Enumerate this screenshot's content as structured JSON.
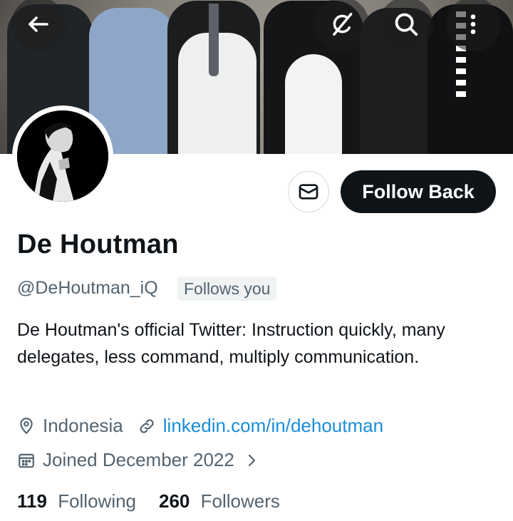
{
  "profile": {
    "name": "De Houtman",
    "handle": "@DeHoutman_iQ",
    "follows_you": "Follows you",
    "bio": "De Houtman's official Twitter: Instruction quickly, many delegates, less command, multiply communication.",
    "location": "Indonesia",
    "website": "linkedin.com/in/dehoutman",
    "joined": "Joined December 2022",
    "following_count": "119",
    "following_label": "Following",
    "followers_count": "260",
    "followers_label": "Followers"
  },
  "actions": {
    "follow_back": "Follow Back"
  },
  "icons": {
    "back": "back-arrow-icon",
    "grok": "grok-icon",
    "search": "search-icon",
    "more": "more-vertical-icon",
    "message": "envelope-icon",
    "location": "location-pin-icon",
    "link": "link-icon",
    "calendar": "calendar-icon",
    "chevron": "chevron-right-icon"
  },
  "colors": {
    "primary_text": "#0f1419",
    "secondary_text": "#536471",
    "link": "#1a8cd8",
    "button_dark": "#0f1419"
  }
}
